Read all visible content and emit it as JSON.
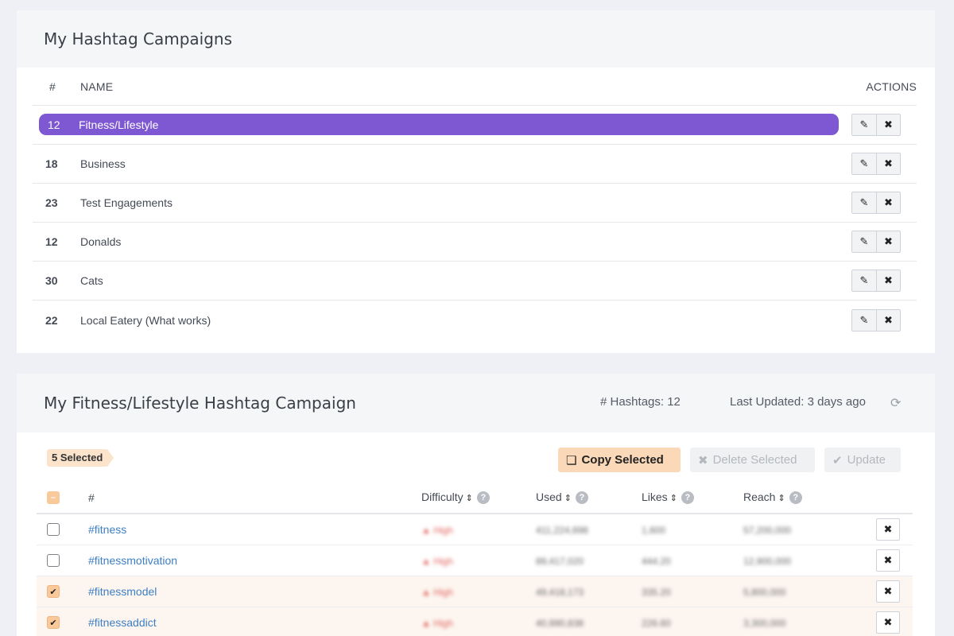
{
  "campaigns_card": {
    "title": "My Hashtag Campaigns",
    "columns": {
      "num": "#",
      "name": "NAME",
      "actions": "ACTIONS"
    },
    "rows": [
      {
        "count": "12",
        "name": "Fitness/Lifestyle",
        "active": true
      },
      {
        "count": "18",
        "name": "Business",
        "active": false
      },
      {
        "count": "23",
        "name": "Test Engagements",
        "active": false
      },
      {
        "count": "12",
        "name": "Donalds",
        "active": false
      },
      {
        "count": "30",
        "name": "Cats",
        "active": false
      },
      {
        "count": "22",
        "name": "Local Eatery (What works)",
        "active": false
      }
    ],
    "edit_icon": "pencil-icon",
    "delete_icon": "close-icon"
  },
  "detail_card": {
    "title": "My Fitness/Lifestyle Hashtag Campaign",
    "hashtag_count": "# Hashtags: 12",
    "last_updated": "Last Updated: 3 days ago",
    "refresh_icon": "refresh-icon",
    "selected_badge": "5 Selected",
    "toolbar": {
      "copy_label": "Copy Selected",
      "delete_label": "Delete Selected",
      "update_label": "Update"
    },
    "columns": {
      "tag": "#",
      "difficulty": "Difficulty",
      "used": "Used",
      "likes": "Likes",
      "reach": "Reach"
    },
    "rows": [
      {
        "tag": "#fitness",
        "difficulty": "High",
        "used": "411,224,698",
        "likes": "1,600",
        "reach": "57,200,000",
        "checked": false
      },
      {
        "tag": "#fitnessmotivation",
        "difficulty": "High",
        "used": "89,417,020",
        "likes": "444.20",
        "reach": "12,900,000",
        "checked": false
      },
      {
        "tag": "#fitnessmodel",
        "difficulty": "High",
        "used": "49,418,173",
        "likes": "335.20",
        "reach": "5,800,000",
        "checked": true
      },
      {
        "tag": "#fitnessaddict",
        "difficulty": "High",
        "used": "40,990,838",
        "likes": "226.60",
        "reach": "3,300,000",
        "checked": true
      }
    ]
  },
  "colors": {
    "accent_purple": "#7e57d2",
    "selection_orange": "#fbd8b8",
    "link_blue": "#3d7fc4",
    "difficulty_red": "#e0605a"
  }
}
